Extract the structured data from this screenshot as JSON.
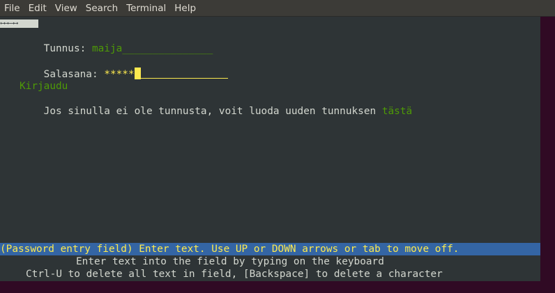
{
  "menubar": {
    "items": [
      "File",
      "Edit",
      "View",
      "Search",
      "Terminal",
      "Help"
    ]
  },
  "terminal": {
    "nav_arrows": "←←←→→",
    "username": {
      "label": "Tunnus:",
      "value": "maija",
      "trailing": "_______________"
    },
    "password": {
      "label": "Salasana:",
      "value": "*****"
    },
    "login_link": "Kirjaudu",
    "register_text": "Jos sinulla ei ole tunnusta, voit luoda uuden tunnuksen",
    "register_link": "tästä",
    "status": "(Password entry field) Enter text. Use UP or DOWN arrows or tab to move off.",
    "help_line1": "Enter text into the field by typing on the keyboard",
    "help_line2": "Ctrl-U to delete all text in field, [Backspace] to delete a character"
  },
  "colors": {
    "terminal_bg": "#2e3436",
    "menubar_bg": "#3c3b37",
    "status_bg": "#3465a4",
    "highlight_yellow": "#fce94f",
    "link_green": "#4e9a06"
  }
}
